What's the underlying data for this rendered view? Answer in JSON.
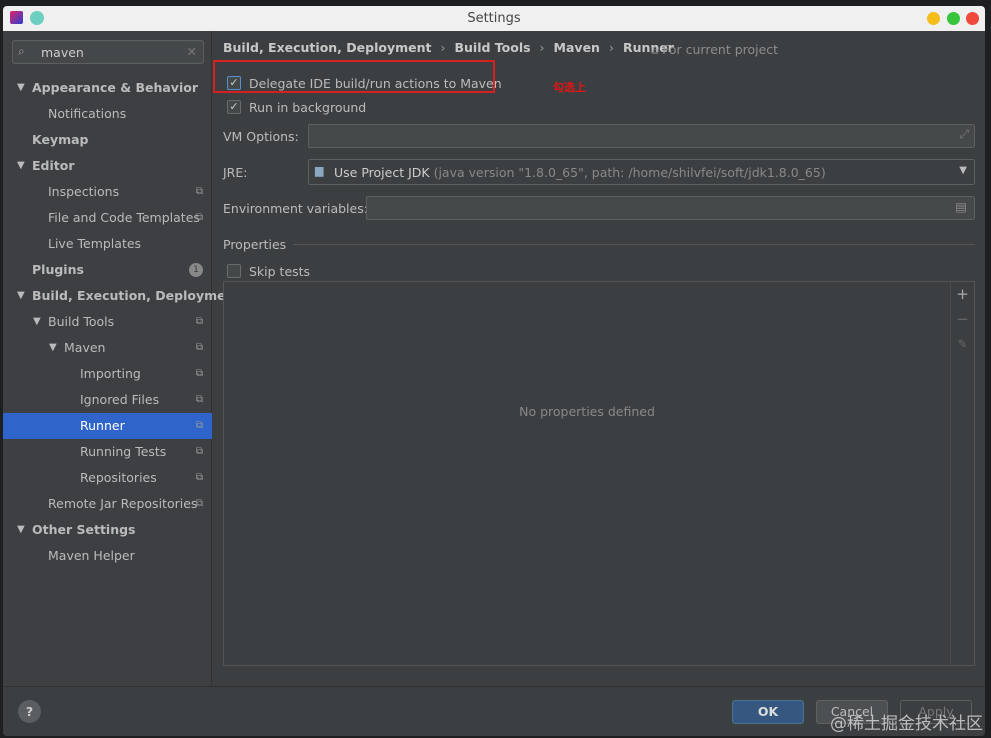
{
  "window": {
    "title": "Settings"
  },
  "search": {
    "value": "maven"
  },
  "tree": [
    {
      "label": "Appearance & Behavior",
      "level": 0,
      "bold": true,
      "arrow": true
    },
    {
      "label": "Notifications",
      "level": 1
    },
    {
      "label": "Keymap",
      "level": 0,
      "bold": true
    },
    {
      "label": "Editor",
      "level": 0,
      "bold": true,
      "arrow": true
    },
    {
      "label": "Inspections",
      "level": 1,
      "copy": true
    },
    {
      "label": "File and Code Templates",
      "level": 1,
      "copy": true
    },
    {
      "label": "Live Templates",
      "level": 1
    },
    {
      "label": "Plugins",
      "level": 0,
      "bold": true,
      "badge": "1"
    },
    {
      "label": "Build, Execution, Deployment",
      "level": 0,
      "bold": true,
      "arrow": true
    },
    {
      "label": "Build Tools",
      "level": 1,
      "arrow": true,
      "copy": true
    },
    {
      "label": "Maven",
      "level": 2,
      "arrow": true,
      "copy": true
    },
    {
      "label": "Importing",
      "level": 3,
      "copy": true
    },
    {
      "label": "Ignored Files",
      "level": 3,
      "copy": true
    },
    {
      "label": "Runner",
      "level": 3,
      "copy": true,
      "selected": true
    },
    {
      "label": "Running Tests",
      "level": 3,
      "copy": true
    },
    {
      "label": "Repositories",
      "level": 3,
      "copy": true
    },
    {
      "label": "Remote Jar Repositories",
      "level": 1,
      "copy": true
    },
    {
      "label": "Other Settings",
      "level": 0,
      "bold": true,
      "arrow": true
    },
    {
      "label": "Maven Helper",
      "level": 1
    }
  ],
  "breadcrumb": [
    "Build, Execution, Deployment",
    "Build Tools",
    "Maven",
    "Runner"
  ],
  "scope": "For current project",
  "annotation": "勾选上",
  "delegate": {
    "label": "Delegate IDE build/run actions to Maven",
    "checked": true
  },
  "background": {
    "label": "Run in background",
    "checked": true
  },
  "vm_options": {
    "label": "VM Options:",
    "value": ""
  },
  "jre": {
    "label": "JRE:",
    "value": "Use Project JDK",
    "detail": "(java version \"1.8.0_65\", path: /home/shilvfei/soft/jdk1.8.0_65)"
  },
  "env": {
    "label": "Environment variables:",
    "value": ""
  },
  "properties": {
    "label": "Properties",
    "skip_tests": "Skip tests",
    "empty": "No properties defined"
  },
  "buttons": {
    "help": "?",
    "ok": "OK",
    "cancel": "Cancel",
    "apply": "Apply"
  },
  "watermark": "@稀土掘金技术社区"
}
